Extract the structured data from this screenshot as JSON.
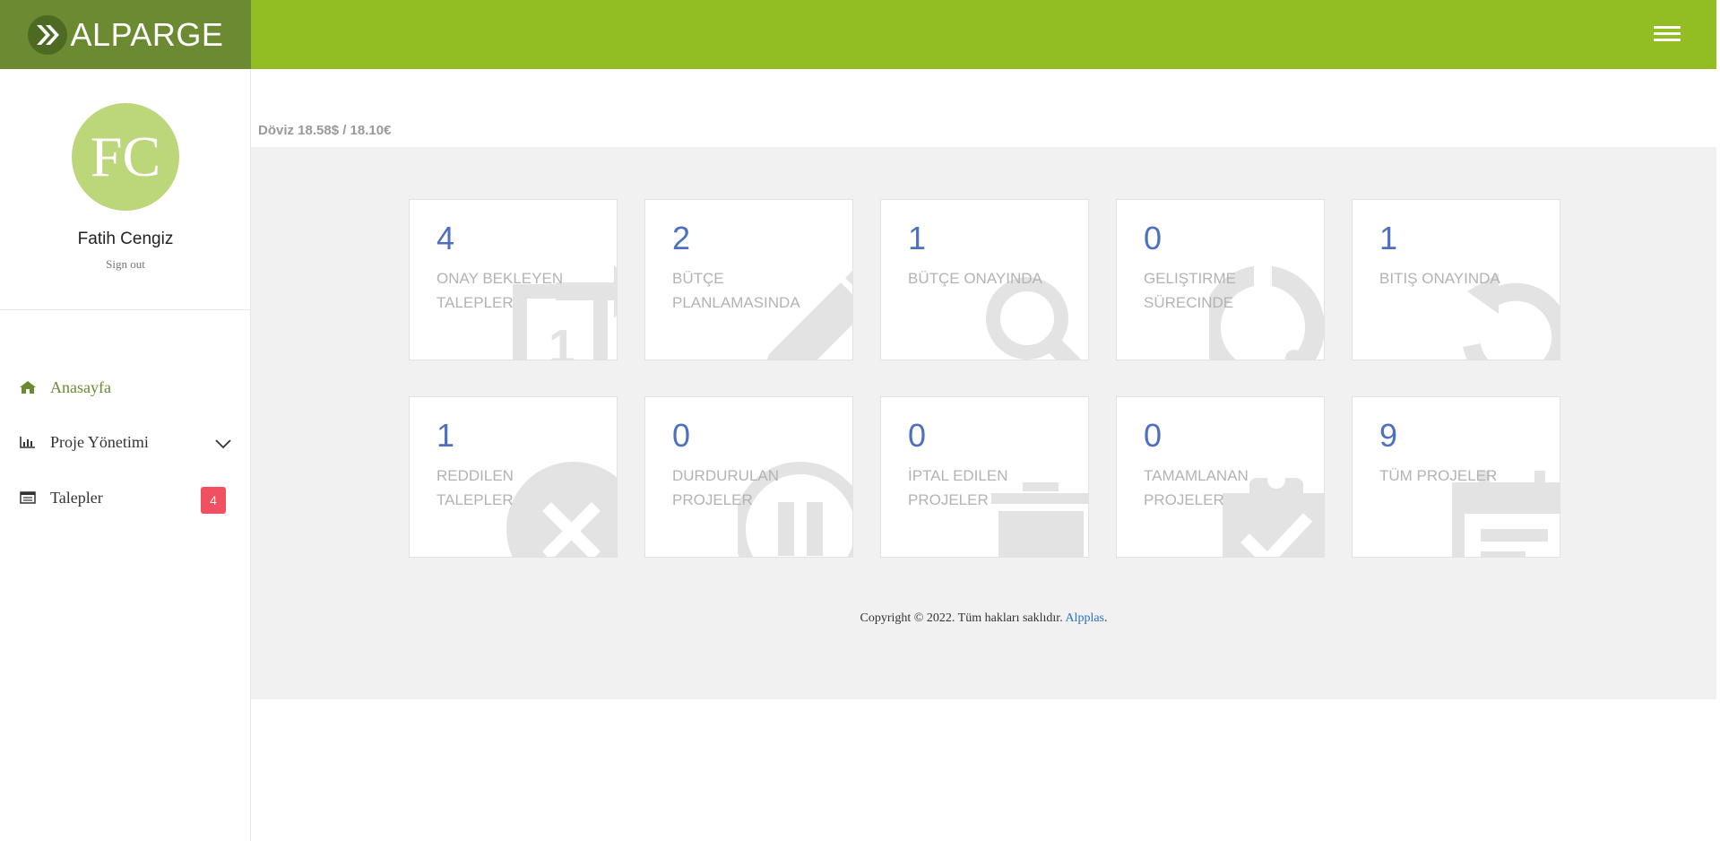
{
  "brand": {
    "name": "ALPARGE"
  },
  "header": {
    "menu_icon": "hamburger-icon"
  },
  "user": {
    "initials": "FC",
    "name": "Fatih Cengiz",
    "sign_out": "Sign out"
  },
  "sidebar": {
    "items": [
      {
        "label": "Anasayfa",
        "icon": "home-icon",
        "active": true
      },
      {
        "label": "Proje Yönetimi",
        "icon": "bar-chart-icon",
        "expandable": true
      },
      {
        "label": "Talepler",
        "icon": "calendar-list-icon",
        "badge": "4"
      }
    ]
  },
  "main": {
    "exchange": "Döviz 18.58$ / 18.10€",
    "tiles": [
      {
        "count": "4",
        "label": "ONAY BEKLEYEN TALEPLER",
        "icon": "calendar-arrow-icon"
      },
      {
        "count": "2",
        "label": "BÜTÇE PLANLAMASINDA",
        "icon": "pencil-icon"
      },
      {
        "count": "1",
        "label": "BÜTÇE ONAYINDA",
        "icon": "search-icon"
      },
      {
        "count": "0",
        "label": "GELIŞTIRME SÜRECINDE",
        "icon": "search-circle-icon"
      },
      {
        "count": "1",
        "label": "BITIŞ ONAYINDA",
        "icon": "refresh-icon"
      },
      {
        "count": "1",
        "label": "REDDILEN TALEPLER",
        "icon": "x-circle-icon"
      },
      {
        "count": "0",
        "label": "DURDURULAN PROJELER",
        "icon": "pause-circle-icon"
      },
      {
        "count": "0",
        "label": "İPTAL EDILEN PROJELER",
        "icon": "trash-icon"
      },
      {
        "count": "0",
        "label": "TAMAMLANAN PROJELER",
        "icon": "clipboard-check-icon"
      },
      {
        "count": "9",
        "label": "TÜM PROJELER",
        "icon": "calendar-icon"
      }
    ]
  },
  "footer": {
    "text": "Copyright © 2022. Tüm hakları saklıdır.",
    "link": "Alpplas",
    "suffix": "."
  },
  "colors": {
    "header_green": "#92be24",
    "logo_bg": "#6b8a32",
    "avatar": "#bcd67a",
    "number_blue": "#4f6fbf",
    "badge_red": "#f0505f"
  }
}
